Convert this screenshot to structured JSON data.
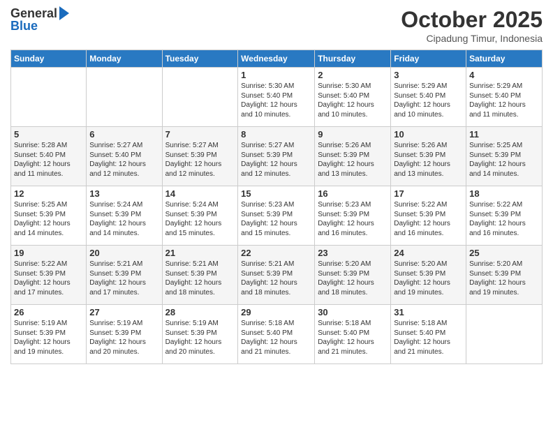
{
  "logo": {
    "general": "General",
    "blue": "Blue"
  },
  "title": "October 2025",
  "subtitle": "Cipadung Timur, Indonesia",
  "days_header": [
    "Sunday",
    "Monday",
    "Tuesday",
    "Wednesday",
    "Thursday",
    "Friday",
    "Saturday"
  ],
  "weeks": [
    [
      {
        "day": "",
        "info": ""
      },
      {
        "day": "",
        "info": ""
      },
      {
        "day": "",
        "info": ""
      },
      {
        "day": "1",
        "info": "Sunrise: 5:30 AM\nSunset: 5:40 PM\nDaylight: 12 hours\nand 10 minutes."
      },
      {
        "day": "2",
        "info": "Sunrise: 5:30 AM\nSunset: 5:40 PM\nDaylight: 12 hours\nand 10 minutes."
      },
      {
        "day": "3",
        "info": "Sunrise: 5:29 AM\nSunset: 5:40 PM\nDaylight: 12 hours\nand 10 minutes."
      },
      {
        "day": "4",
        "info": "Sunrise: 5:29 AM\nSunset: 5:40 PM\nDaylight: 12 hours\nand 11 minutes."
      }
    ],
    [
      {
        "day": "5",
        "info": "Sunrise: 5:28 AM\nSunset: 5:40 PM\nDaylight: 12 hours\nand 11 minutes."
      },
      {
        "day": "6",
        "info": "Sunrise: 5:27 AM\nSunset: 5:40 PM\nDaylight: 12 hours\nand 12 minutes."
      },
      {
        "day": "7",
        "info": "Sunrise: 5:27 AM\nSunset: 5:39 PM\nDaylight: 12 hours\nand 12 minutes."
      },
      {
        "day": "8",
        "info": "Sunrise: 5:27 AM\nSunset: 5:39 PM\nDaylight: 12 hours\nand 12 minutes."
      },
      {
        "day": "9",
        "info": "Sunrise: 5:26 AM\nSunset: 5:39 PM\nDaylight: 12 hours\nand 13 minutes."
      },
      {
        "day": "10",
        "info": "Sunrise: 5:26 AM\nSunset: 5:39 PM\nDaylight: 12 hours\nand 13 minutes."
      },
      {
        "day": "11",
        "info": "Sunrise: 5:25 AM\nSunset: 5:39 PM\nDaylight: 12 hours\nand 14 minutes."
      }
    ],
    [
      {
        "day": "12",
        "info": "Sunrise: 5:25 AM\nSunset: 5:39 PM\nDaylight: 12 hours\nand 14 minutes."
      },
      {
        "day": "13",
        "info": "Sunrise: 5:24 AM\nSunset: 5:39 PM\nDaylight: 12 hours\nand 14 minutes."
      },
      {
        "day": "14",
        "info": "Sunrise: 5:24 AM\nSunset: 5:39 PM\nDaylight: 12 hours\nand 15 minutes."
      },
      {
        "day": "15",
        "info": "Sunrise: 5:23 AM\nSunset: 5:39 PM\nDaylight: 12 hours\nand 15 minutes."
      },
      {
        "day": "16",
        "info": "Sunrise: 5:23 AM\nSunset: 5:39 PM\nDaylight: 12 hours\nand 16 minutes."
      },
      {
        "day": "17",
        "info": "Sunrise: 5:22 AM\nSunset: 5:39 PM\nDaylight: 12 hours\nand 16 minutes."
      },
      {
        "day": "18",
        "info": "Sunrise: 5:22 AM\nSunset: 5:39 PM\nDaylight: 12 hours\nand 16 minutes."
      }
    ],
    [
      {
        "day": "19",
        "info": "Sunrise: 5:22 AM\nSunset: 5:39 PM\nDaylight: 12 hours\nand 17 minutes."
      },
      {
        "day": "20",
        "info": "Sunrise: 5:21 AM\nSunset: 5:39 PM\nDaylight: 12 hours\nand 17 minutes."
      },
      {
        "day": "21",
        "info": "Sunrise: 5:21 AM\nSunset: 5:39 PM\nDaylight: 12 hours\nand 18 minutes."
      },
      {
        "day": "22",
        "info": "Sunrise: 5:21 AM\nSunset: 5:39 PM\nDaylight: 12 hours\nand 18 minutes."
      },
      {
        "day": "23",
        "info": "Sunrise: 5:20 AM\nSunset: 5:39 PM\nDaylight: 12 hours\nand 18 minutes."
      },
      {
        "day": "24",
        "info": "Sunrise: 5:20 AM\nSunset: 5:39 PM\nDaylight: 12 hours\nand 19 minutes."
      },
      {
        "day": "25",
        "info": "Sunrise: 5:20 AM\nSunset: 5:39 PM\nDaylight: 12 hours\nand 19 minutes."
      }
    ],
    [
      {
        "day": "26",
        "info": "Sunrise: 5:19 AM\nSunset: 5:39 PM\nDaylight: 12 hours\nand 19 minutes."
      },
      {
        "day": "27",
        "info": "Sunrise: 5:19 AM\nSunset: 5:39 PM\nDaylight: 12 hours\nand 20 minutes."
      },
      {
        "day": "28",
        "info": "Sunrise: 5:19 AM\nSunset: 5:39 PM\nDaylight: 12 hours\nand 20 minutes."
      },
      {
        "day": "29",
        "info": "Sunrise: 5:18 AM\nSunset: 5:40 PM\nDaylight: 12 hours\nand 21 minutes."
      },
      {
        "day": "30",
        "info": "Sunrise: 5:18 AM\nSunset: 5:40 PM\nDaylight: 12 hours\nand 21 minutes."
      },
      {
        "day": "31",
        "info": "Sunrise: 5:18 AM\nSunset: 5:40 PM\nDaylight: 12 hours\nand 21 minutes."
      },
      {
        "day": "",
        "info": ""
      }
    ]
  ]
}
